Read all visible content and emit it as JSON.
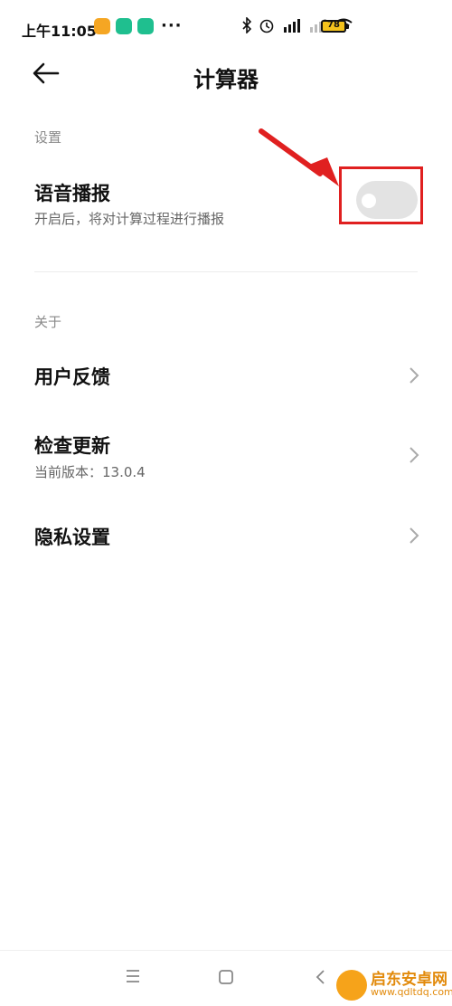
{
  "status_bar": {
    "time": "上午11:05",
    "more": "···",
    "battery": "78",
    "app_icon_colors": [
      "#f5a623",
      "#1fbf8f",
      "#1fbf8f"
    ]
  },
  "header": {
    "back_icon": "arrow-left-icon",
    "title": "计算器"
  },
  "settings_section": {
    "label": "设置",
    "voice": {
      "title": "语音播报",
      "subtitle": "开启后，将对计算过程进行播报",
      "toggle_on": false
    }
  },
  "about_section": {
    "label": "关于",
    "items": [
      {
        "title": "用户反馈",
        "subtitle": ""
      },
      {
        "title": "检查更新",
        "subtitle": "当前版本：13.0.4"
      },
      {
        "title": "隐私设置",
        "subtitle": ""
      }
    ]
  },
  "annotation_color": "#e02020",
  "nav": {
    "menu_icon": "menu-icon",
    "home_icon": "home-square-icon",
    "back_icon": "back-chevron-icon"
  },
  "watermark": {
    "title": "启东安卓网",
    "url": "www.qdltdq.com"
  }
}
